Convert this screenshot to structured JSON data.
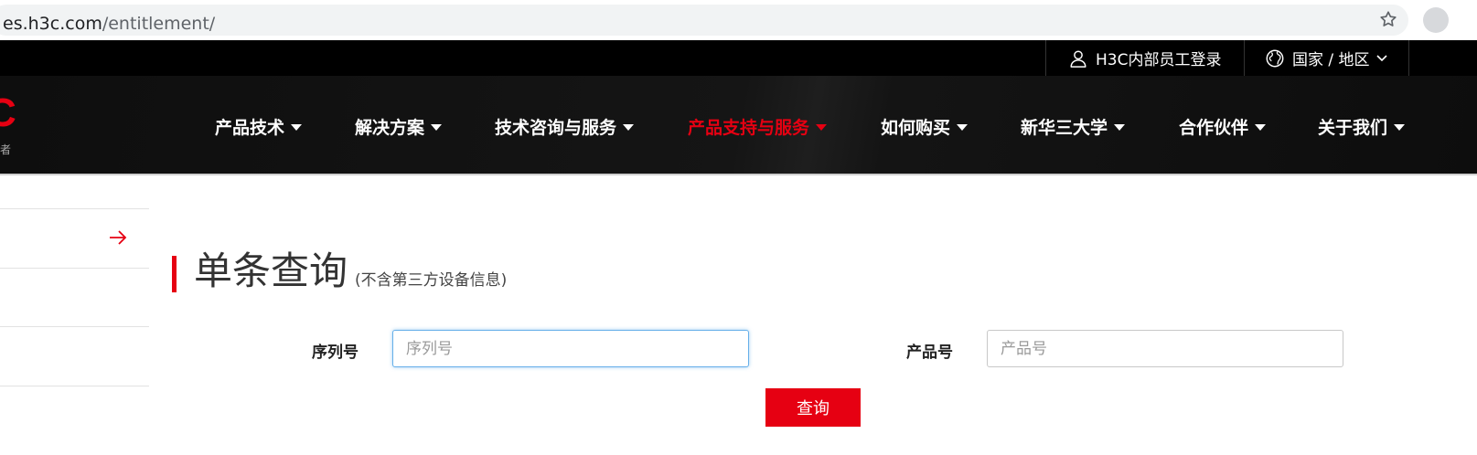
{
  "browser": {
    "url_host": "es.h3c.com",
    "url_path": "/entitlement/"
  },
  "utility_bar": {
    "employee_login": "H3C内部员工登录",
    "region": "国家 / 地区"
  },
  "logo": {
    "text_fragment": "C",
    "sub_fragment": "者"
  },
  "nav": {
    "items": [
      {
        "label": "产品技术",
        "active": false
      },
      {
        "label": "解决方案",
        "active": false
      },
      {
        "label": "技术咨询与服务",
        "active": false
      },
      {
        "label": "产品支持与服务",
        "active": true
      },
      {
        "label": "如何购买",
        "active": false
      },
      {
        "label": "新华三大学",
        "active": false
      },
      {
        "label": "合作伙伴",
        "active": false
      },
      {
        "label": "关于我们",
        "active": false
      }
    ],
    "active_color": "#e60012"
  },
  "page": {
    "title": "单条查询",
    "subtitle": "(不含第三方设备信息)"
  },
  "form": {
    "serial": {
      "label": "序列号",
      "placeholder": "序列号",
      "value": ""
    },
    "product": {
      "label": "产品号",
      "placeholder": "产品号",
      "value": ""
    },
    "submit_label": "查询"
  },
  "colors": {
    "brand_red": "#e60012",
    "nav_bg": "#111111"
  }
}
